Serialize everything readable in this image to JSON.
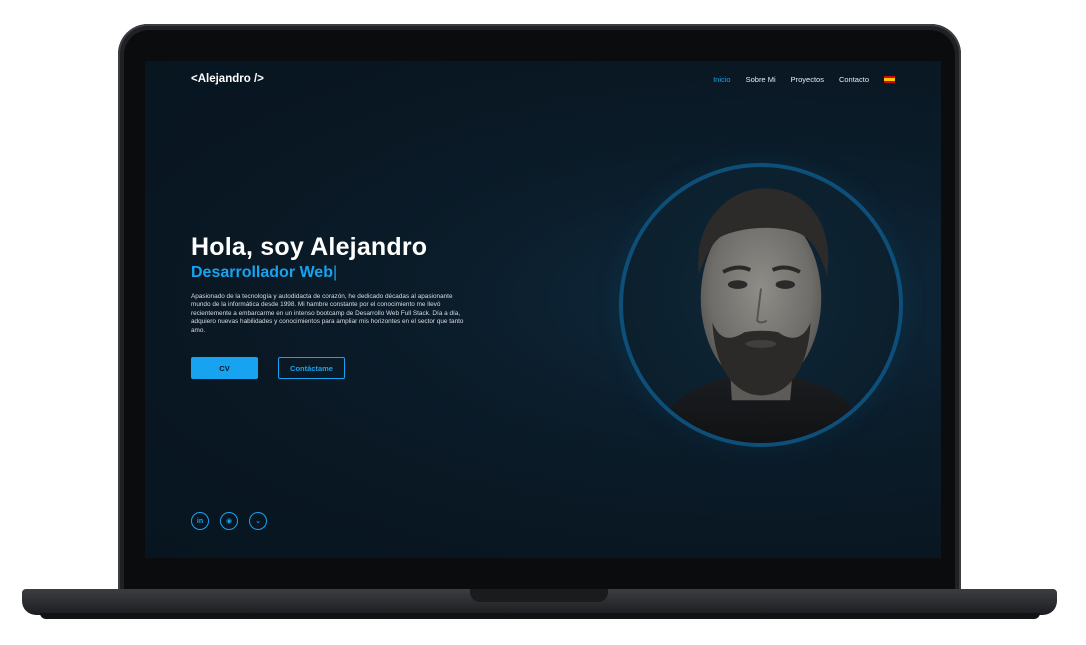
{
  "nav": {
    "logo": "<Alejandro />",
    "links": [
      "Inicio",
      "Sobre Mi",
      "Proyectos",
      "Contacto"
    ],
    "active": "Inicio",
    "language_icon": "spain-flag-icon"
  },
  "hero": {
    "title": "Hola, soy Alejandro",
    "subtitle": "Desarrollador Web",
    "caret": "|",
    "description": "Apasionado de la tecnología y autodidacta de corazón, he dedicado décadas al apasionante mundo de la informática desde 1998. Mi hambre constante por el conocimiento me llevó recientemente a embarcarme en un intenso bootcamp de Desarrollo Web Full Stack. Día a día, adquiero nuevas habilidades y conocimientos para ampliar mis horizontes en el sector que tanto amo.",
    "cv_button": "CV",
    "contact_button": "Contáctame"
  },
  "socials": [
    {
      "name": "linkedin-icon",
      "glyph": "in"
    },
    {
      "name": "github-icon",
      "glyph": "◉"
    },
    {
      "name": "gitlab-icon",
      "glyph": "⌄"
    }
  ],
  "colors": {
    "accent": "#18a3f0",
    "background": "#0b1c2a",
    "text": "#ffffff"
  }
}
